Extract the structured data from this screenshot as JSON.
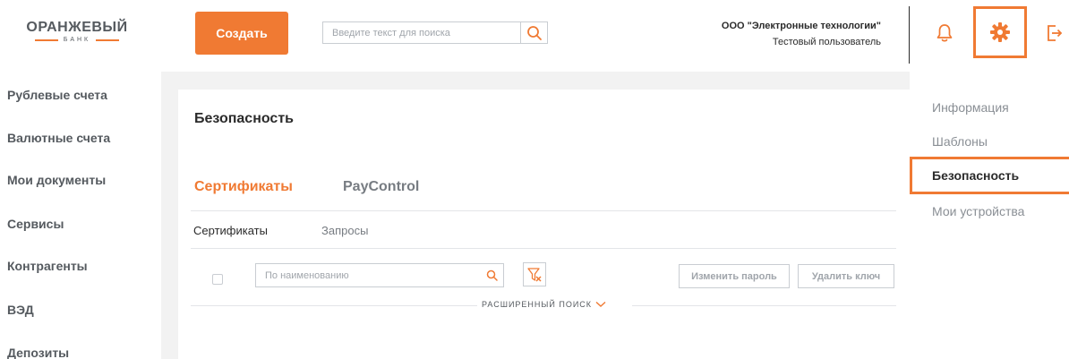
{
  "logo": {
    "title": "ОРАНЖЕВЫЙ",
    "subtitle": "БАНК"
  },
  "header": {
    "create_label": "Создать",
    "search_placeholder": "Введите текст для поиска",
    "org_name": "ООО \"Электронные технологии\"",
    "user_name": "Тестовый пользователь"
  },
  "left_nav": {
    "items": [
      {
        "label": "Рублевые счета"
      },
      {
        "label": "Валютные счета"
      },
      {
        "label": "Мои документы"
      },
      {
        "label": "Сервисы"
      },
      {
        "label": "Контрагенты"
      },
      {
        "label": "ВЭД"
      },
      {
        "label": "Депозиты"
      }
    ]
  },
  "main": {
    "title": "Безопасность",
    "tabs": [
      {
        "label": "Сертификаты",
        "active": true
      },
      {
        "label": "PayControl",
        "active": false
      }
    ],
    "subtabs": [
      {
        "label": "Сертификаты",
        "active": true
      },
      {
        "label": "Запросы",
        "active": false
      }
    ],
    "filter_placeholder": "По наименованию",
    "change_password_label": "Изменить пароль",
    "delete_key_label": "Удалить ключ",
    "advanced_search_label": "РАСШИРЕННЫЙ ПОИСК"
  },
  "right_nav": {
    "items": [
      {
        "label": "Информация"
      },
      {
        "label": "Шаблоны"
      },
      {
        "label": "Безопасность",
        "active": true
      },
      {
        "label": "Мои устройства"
      }
    ]
  },
  "colors": {
    "accent": "#f07a33",
    "text_dark": "#2b2b2b",
    "text_gray": "#777c82",
    "background_gray": "#f2f2f2"
  },
  "icons": [
    "search-icon",
    "bell-icon",
    "gear-icon",
    "logout-icon",
    "filter-clear-icon",
    "chevron-down-icon"
  ]
}
